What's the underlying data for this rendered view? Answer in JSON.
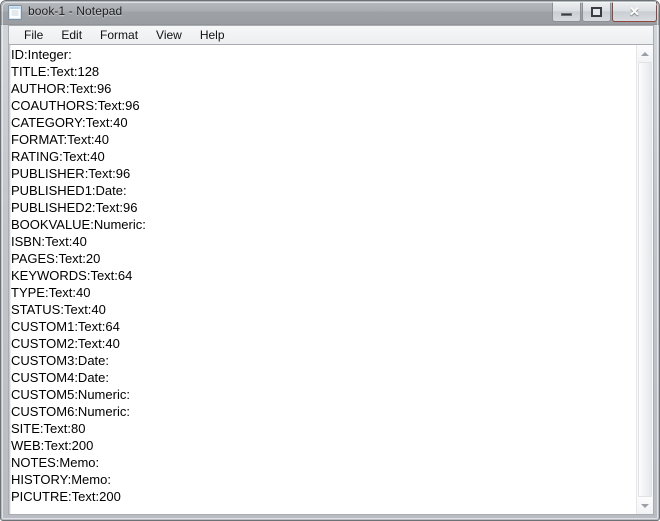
{
  "window": {
    "title": "book-1 - Notepad",
    "icon": "notepad-icon",
    "caption_buttons": {
      "minimize_label": "—",
      "maximize_label": "□",
      "close_label": "✕"
    },
    "colors": {
      "close_button": "#cf3c26",
      "titlebar": "#a9adb2",
      "frame": "#c3c7cc",
      "text": "#000000",
      "client_background": "#ffffff"
    }
  },
  "menubar": {
    "items": [
      {
        "label": "File"
      },
      {
        "label": "Edit"
      },
      {
        "label": "Format"
      },
      {
        "label": "View"
      },
      {
        "label": "Help"
      }
    ]
  },
  "document": {
    "lines": [
      "ID:Integer:",
      "TITLE:Text:128",
      "AUTHOR:Text:96",
      "COAUTHORS:Text:96",
      "CATEGORY:Text:40",
      "FORMAT:Text:40",
      "RATING:Text:40",
      "PUBLISHER:Text:96",
      "PUBLISHED1:Date:",
      "PUBLISHED2:Text:96",
      "BOOKVALUE:Numeric:",
      "ISBN:Text:40",
      "PAGES:Text:20",
      "KEYWORDS:Text:64",
      "TYPE:Text:40",
      "STATUS:Text:40",
      "CUSTOM1:Text:64",
      "CUSTOM2:Text:40",
      "CUSTOM3:Date:",
      "CUSTOM4:Date:",
      "CUSTOM5:Numeric:",
      "CUSTOM6:Numeric:",
      "SITE:Text:80",
      "WEB:Text:200",
      "NOTES:Memo:",
      "HISTORY:Memo:",
      "PICUTRE:Text:200"
    ]
  },
  "scrollbar": {
    "orientation": "vertical",
    "up_arrow": "scroll-up-icon",
    "down_arrow": "scroll-down-icon"
  }
}
